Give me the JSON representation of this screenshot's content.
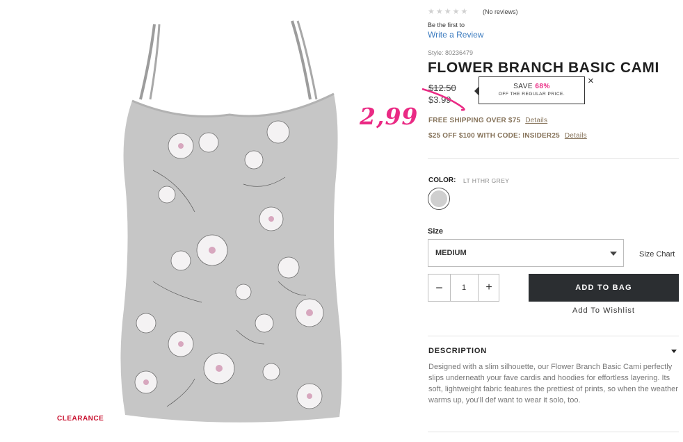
{
  "product": {
    "clearance_label": "CLEARANCE",
    "rating_stars": "★★★★★",
    "reviews_text": "(No reviews)",
    "be_first": "Be the first to",
    "write_review": "Write a Review",
    "style": "Style: 80236479",
    "title": "FLOWER BRANCH BASIC CAMI",
    "old_price": "$12.50",
    "new_price": "$3.99",
    "handwritten_price": "2,99",
    "handwritten_color": "#ea2a84"
  },
  "save_tooltip": {
    "save_prefix": "SAVE",
    "save_percent": "68%",
    "note": "OFF THE REGULAR PRICE.",
    "close": "×"
  },
  "promos": [
    {
      "text": "FREE SHIPPING OVER $75",
      "link": "Details"
    },
    {
      "text": "$25 OFF $100 WITH CODE: INSIDER25",
      "link": "Details"
    }
  ],
  "color": {
    "label": "COLOR:",
    "value": "LT HTHR GREY"
  },
  "size": {
    "label": "Size",
    "selected": "MEDIUM",
    "chart_link": "Size Chart"
  },
  "quantity": {
    "minus": "−",
    "value": "1",
    "plus": "+"
  },
  "actions": {
    "add_to_bag": "ADD TO BAG",
    "wishlist": "Add To Wishlist"
  },
  "description": {
    "title": "DESCRIPTION",
    "text": "Designed with a slim silhouette, our Flower Branch Basic Cami perfectly slips underneath your fave cardis and hoodies for effortless layering. Its soft, lightweight fabric features the prettiest of prints, so when the weather warms up, you'll def want to wear it solo, too."
  }
}
